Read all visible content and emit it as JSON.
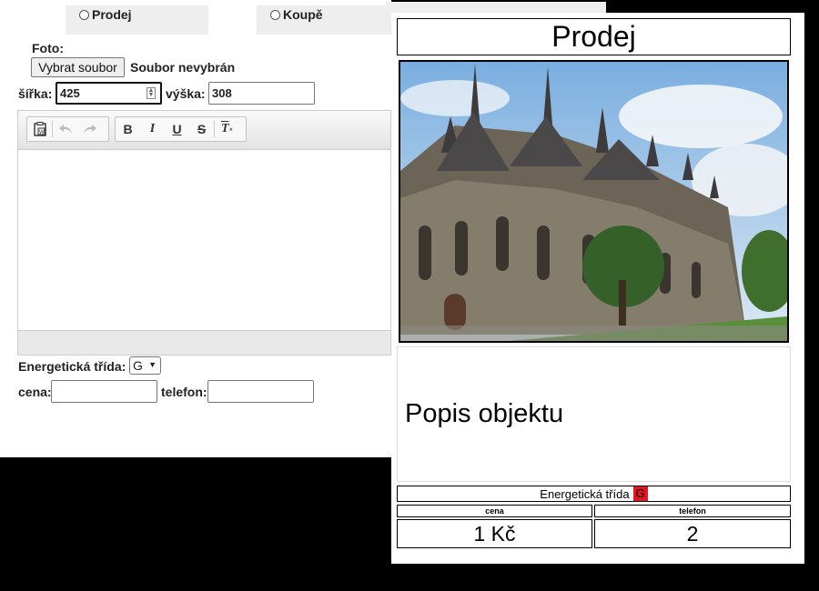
{
  "tabs": {
    "prodej_label": "Prodej",
    "koupe_label": "Koupě"
  },
  "form": {
    "foto_label": "Foto:",
    "choose_file_button": "Vybrat soubor",
    "no_file_text": "Soubor nevybrán",
    "width_label": "šířka:",
    "width_value": "425",
    "height_label": "výška:",
    "height_value": "308",
    "energy_label": "Energetická třída:",
    "energy_selected": "G",
    "price_label": "cena:",
    "price_value": "",
    "phone_label": "telefon:",
    "phone_value": ""
  },
  "toolbar": {
    "icons": [
      "paste-word-icon",
      "undo-icon",
      "redo-icon",
      "bold-icon",
      "italic-icon",
      "underline-icon",
      "strikethrough-icon",
      "remove-format-icon"
    ],
    "bold": "B",
    "italic": "I",
    "underline": "U",
    "strike": "S",
    "clear": "T"
  },
  "preview": {
    "title": "Prodej",
    "description": "Popis objektu",
    "energy_label": "Energetická třída",
    "energy_class": "G",
    "energy_color": "#e2171f",
    "price_header": "cena",
    "phone_header": "telefon",
    "price_value": "1 Kč",
    "phone_value": "2"
  }
}
